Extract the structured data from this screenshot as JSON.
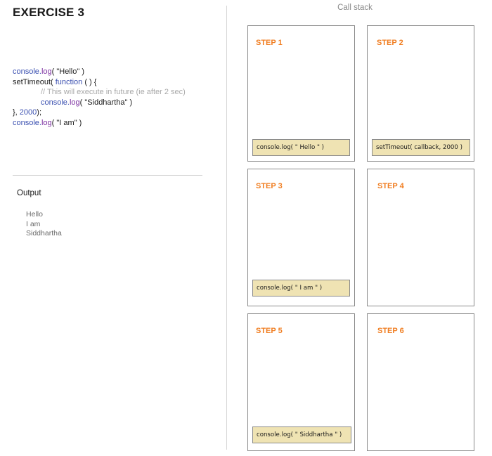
{
  "title": "EXERCISE 3",
  "code": {
    "l1": {
      "a": "console.",
      "b": "log",
      "c": "( \"Hello\" )"
    },
    "l2": {
      "a": "setTimeout( ",
      "b": "function",
      "c": " ( ) {"
    },
    "l3": {
      "comment": "// This will execute in future (ie after 2 sec)"
    },
    "l4": {
      "a": "console.",
      "b": "log",
      "c": "( \"Siddhartha\" )"
    },
    "l5": {
      "a": "}, ",
      "b": "2000",
      "c": ");"
    },
    "l6": {
      "a": "console.",
      "b": "log",
      "c": "( \"I am\" )"
    }
  },
  "output": {
    "label": "Output",
    "lines": [
      "Hello",
      "I am",
      "Siddhartha"
    ]
  },
  "call_stack": {
    "title": "Call stack",
    "steps": [
      {
        "label": "STEP 1",
        "frame": "console.log( \" Hello \" )"
      },
      {
        "label": "STEP 2",
        "frame": "setTimeout( callback, 2000 )"
      },
      {
        "label": "STEP 3",
        "frame": "console.log( \" I am \" )"
      },
      {
        "label": "STEP 4",
        "frame": ""
      },
      {
        "label": "STEP 5",
        "frame": "console.log( \" Siddhartha \" )"
      },
      {
        "label": "STEP 6",
        "frame": ""
      }
    ]
  },
  "colors": {
    "step_label": "#f07e22",
    "frame_fill": "#efe3b3",
    "keyword": "#7b2ea0",
    "function_call": "#3a4fb0",
    "comment": "#a8a8a8"
  }
}
